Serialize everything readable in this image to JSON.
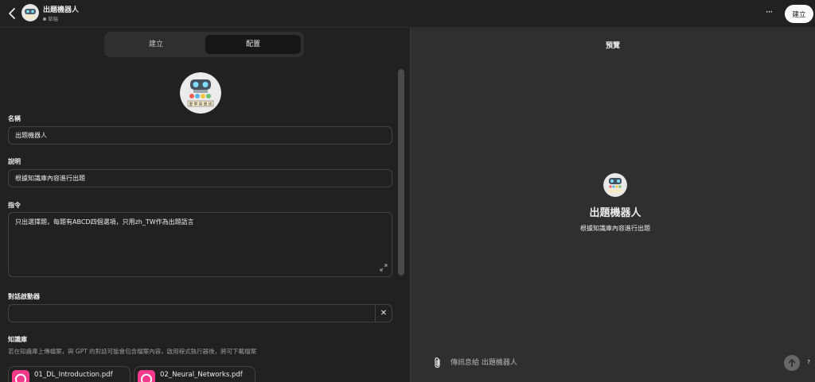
{
  "header": {
    "title": "出題機器人",
    "status": "草稿",
    "more_label": "···",
    "create_label": "建立"
  },
  "tabs": [
    {
      "label": "建立",
      "active": false
    },
    {
      "label": "配置",
      "active": true
    }
  ],
  "form": {
    "name_label": "名稱",
    "name_value": "出題機器人",
    "description_label": "說明",
    "description_value": "根據知識庫內容進行出題",
    "instructions_label": "指令",
    "instructions_value": "只出選擇題，每題有ABCD四個選項，只用zh_TW作為出題語言",
    "starters_label": "對話啟動器",
    "starter_value": "",
    "clear_label": "✕",
    "knowledge_label": "知識庫",
    "knowledge_description": "若在知識庫上傳檔案，與 GPT 的對話可能會包含檔案內容，啟用程式執行器後，將可下載檔案",
    "files": [
      {
        "name": "01_DL_Introduction.pdf"
      },
      {
        "name": "02_Neural_Networks.pdf"
      }
    ]
  },
  "preview": {
    "title": "預覽",
    "gpt_name": "出題機器人",
    "gpt_description": "根據知識庫內容進行出題",
    "input_placeholder": "傳訊息給 出題機器人",
    "help_label": "?"
  },
  "logo": {
    "caption": "愛 學 習 資 訊"
  },
  "colors": {
    "accent_file": "#f93a8d",
    "panel_left": "#212121",
    "panel_right": "#2f2f2f",
    "create_button_bg": "#ffffff"
  }
}
